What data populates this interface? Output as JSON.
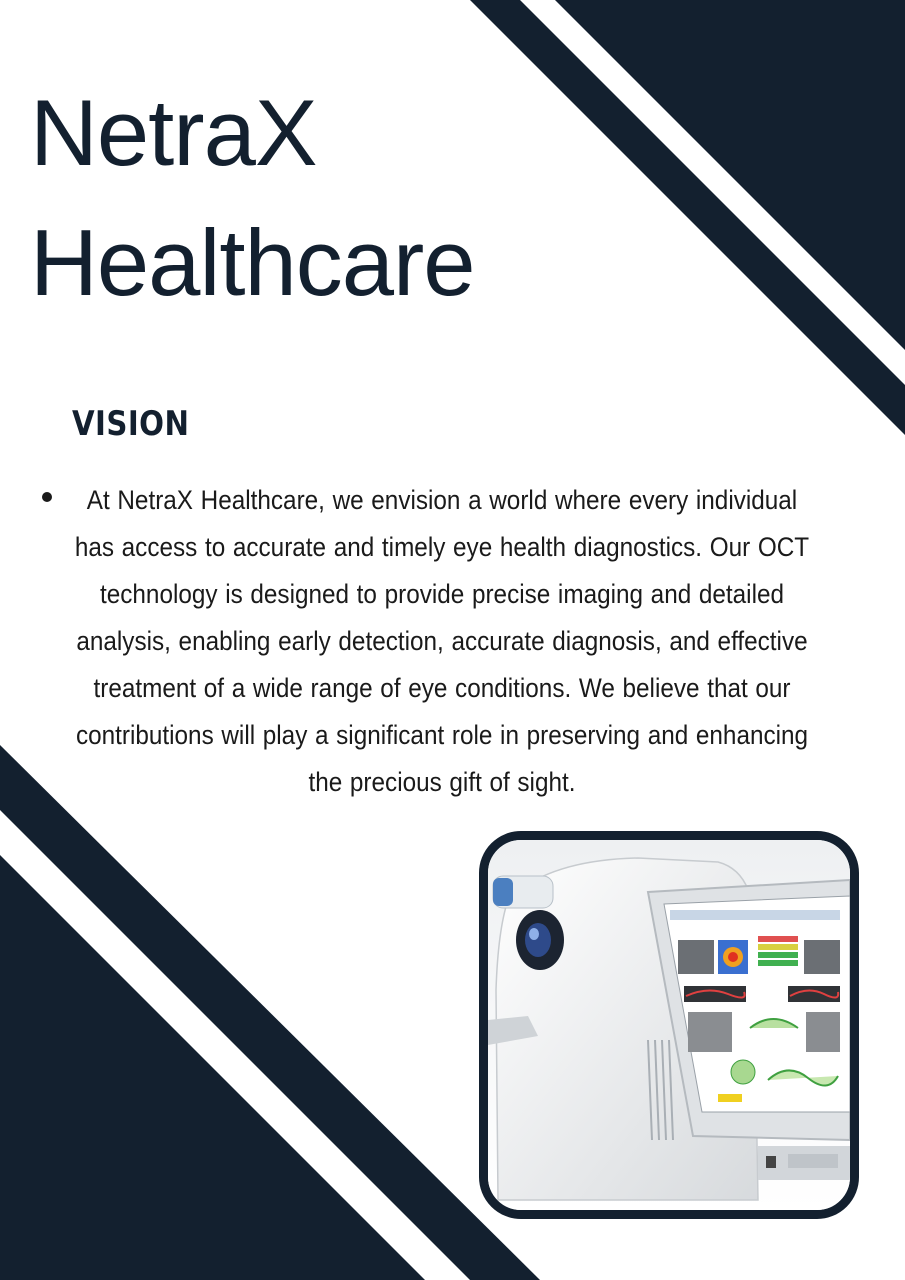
{
  "document": {
    "title_line1": "NetraX",
    "title_line2": "Healthcare",
    "section_heading": "VISION",
    "vision_text": "At NetraX Healthcare, we envision a world where every individual has access to accurate and timely eye health diagnostics. Our OCT technology is designed to provide precise imaging and detailed analysis, enabling early detection, accurate diagnosis, and effective treatment of a wide range of eye conditions. We believe that our contributions will play a significant role in preserving and enhancing the precious gift of sight."
  },
  "colors": {
    "navy": "#13202f",
    "white": "#ffffff"
  },
  "image": {
    "subject": "OCT imaging device photo",
    "icon": "oct-device-image"
  }
}
